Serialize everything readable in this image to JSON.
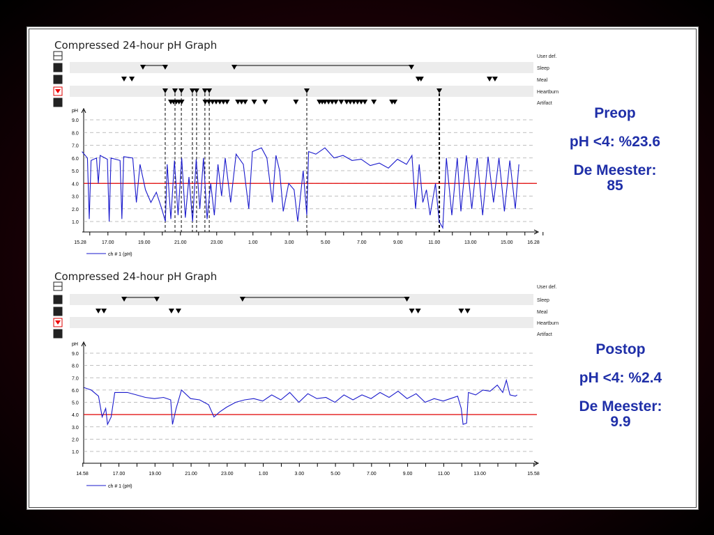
{
  "chart_data": [
    {
      "type": "line",
      "title": "Compressed 24-hour pH Graph",
      "row_labels": [
        "User def.",
        "Sleep",
        "Meal",
        "Heartburn",
        "Artifact"
      ],
      "ylabel": "pH",
      "ylim": [
        0,
        10
      ],
      "yticks": [
        "1.0",
        "2.0",
        "3.0",
        "4.0",
        "5.0",
        "6.0",
        "7.0",
        "8.0",
        "9.0"
      ],
      "threshold": 4.0,
      "xlim_hours": [
        0,
        25
      ],
      "xticks": [
        {
          "h": 0,
          "label": "15.28"
        },
        {
          "h": 1.53,
          "label": "17.00"
        },
        {
          "h": 3.53,
          "label": "19.00"
        },
        {
          "h": 5.53,
          "label": "21.00"
        },
        {
          "h": 7.53,
          "label": "23.00"
        },
        {
          "h": 9.53,
          "label": "1.00"
        },
        {
          "h": 11.53,
          "label": "3.00"
        },
        {
          "h": 13.53,
          "label": "5.00"
        },
        {
          "h": 15.53,
          "label": "7.00"
        },
        {
          "h": 17.53,
          "label": "9.00"
        },
        {
          "h": 19.53,
          "label": "11.00"
        },
        {
          "h": 21.53,
          "label": "13.00"
        },
        {
          "h": 23.53,
          "label": "15.00"
        },
        {
          "h": 25,
          "label": "16.28"
        }
      ],
      "legend": "ch # 1 (pH)",
      "events": {
        "sleep": [
          [
            3.46,
            4.69
          ],
          [
            8.5,
            18.27
          ]
        ],
        "meal": [
          2.42,
          2.85,
          18.65,
          18.8,
          22.58,
          22.88
        ],
        "heartburn": [
          4.69,
          5.23,
          5.58,
          6.19,
          6.42,
          6.88,
          7.12,
          12.5,
          19.81
        ],
        "artifact": [
          5.0,
          5.15,
          5.3,
          5.45,
          5.6,
          6.9,
          7.1,
          7.3,
          7.5,
          7.7,
          7.9,
          8.1,
          8.7,
          8.9,
          9.1,
          9.6,
          10.2,
          11.9,
          13.2,
          13.35,
          13.5,
          13.7,
          13.9,
          14.1,
          14.4,
          14.7,
          14.9,
          15.1,
          15.3,
          15.5,
          15.7,
          16.2,
          17.2,
          17.35
        ]
      },
      "series": [
        {
          "name": "ch # 1 (pH)",
          "points": [
            [
              0.1,
              6.5
            ],
            [
              0.4,
              6.0
            ],
            [
              0.5,
              1.2
            ],
            [
              0.6,
              5.8
            ],
            [
              0.9,
              6.0
            ],
            [
              1.0,
              4.0
            ],
            [
              1.1,
              6.2
            ],
            [
              1.5,
              5.9
            ],
            [
              1.6,
              1.0
            ],
            [
              1.7,
              6.0
            ],
            [
              2.2,
              5.8
            ],
            [
              2.3,
              1.2
            ],
            [
              2.4,
              6.1
            ],
            [
              2.9,
              6.0
            ],
            [
              3.1,
              2.5
            ],
            [
              3.3,
              5.5
            ],
            [
              3.6,
              3.5
            ],
            [
              3.9,
              2.5
            ],
            [
              4.2,
              3.3
            ],
            [
              4.5,
              2.0
            ],
            [
              4.7,
              1.0
            ],
            [
              4.8,
              5.5
            ],
            [
              5.0,
              1.2
            ],
            [
              5.2,
              5.8
            ],
            [
              5.4,
              1.5
            ],
            [
              5.6,
              6.0
            ],
            [
              5.8,
              1.3
            ],
            [
              6.0,
              4.5
            ],
            [
              6.2,
              1.0
            ],
            [
              6.4,
              5.9
            ],
            [
              6.6,
              2.0
            ],
            [
              6.8,
              6.0
            ],
            [
              7.0,
              1.2
            ],
            [
              7.2,
              4.0
            ],
            [
              7.4,
              1.5
            ],
            [
              7.6,
              5.5
            ],
            [
              7.8,
              3.0
            ],
            [
              8.0,
              6.0
            ],
            [
              8.3,
              2.5
            ],
            [
              8.6,
              6.3
            ],
            [
              9.0,
              5.5
            ],
            [
              9.3,
              2.0
            ],
            [
              9.5,
              6.5
            ],
            [
              10.0,
              6.8
            ],
            [
              10.3,
              6.0
            ],
            [
              10.6,
              2.5
            ],
            [
              10.8,
              6.2
            ],
            [
              11.0,
              5.0
            ],
            [
              11.2,
              1.8
            ],
            [
              11.5,
              4.0
            ],
            [
              11.8,
              3.5
            ],
            [
              12.0,
              1.0
            ],
            [
              12.3,
              5.0
            ],
            [
              12.5,
              1.5
            ],
            [
              12.6,
              6.5
            ],
            [
              13.0,
              6.3
            ],
            [
              13.5,
              6.8
            ],
            [
              14.0,
              6.0
            ],
            [
              14.5,
              6.2
            ],
            [
              15.0,
              5.8
            ],
            [
              15.5,
              5.9
            ],
            [
              16.0,
              5.4
            ],
            [
              16.5,
              5.6
            ],
            [
              17.0,
              5.2
            ],
            [
              17.5,
              5.9
            ],
            [
              18.0,
              5.5
            ],
            [
              18.3,
              6.2
            ],
            [
              18.5,
              2.0
            ],
            [
              18.7,
              5.5
            ],
            [
              18.9,
              2.5
            ],
            [
              19.1,
              3.5
            ],
            [
              19.3,
              1.5
            ],
            [
              19.6,
              4.0
            ],
            [
              19.8,
              1.0
            ],
            [
              20.0,
              0.5
            ],
            [
              20.2,
              6.0
            ],
            [
              20.5,
              1.5
            ],
            [
              20.8,
              6.0
            ],
            [
              21.0,
              1.8
            ],
            [
              21.3,
              6.2
            ],
            [
              21.6,
              2.0
            ],
            [
              21.9,
              6.0
            ],
            [
              22.2,
              1.5
            ],
            [
              22.5,
              6.1
            ],
            [
              22.8,
              2.5
            ],
            [
              23.1,
              6.0
            ],
            [
              23.4,
              1.8
            ],
            [
              23.7,
              5.8
            ],
            [
              24.0,
              2.0
            ],
            [
              24.2,
              5.5
            ]
          ]
        }
      ]
    },
    {
      "type": "line",
      "title": "Compressed 24-hour pH Graph",
      "row_labels": [
        "User def.",
        "Sleep",
        "Meal",
        "Heartburn",
        "Artifact"
      ],
      "ylabel": "pH",
      "ylim": [
        0,
        10
      ],
      "yticks": [
        "1.0",
        "2.0",
        "3.0",
        "4.0",
        "5.0",
        "6.0",
        "7.0",
        "8.0",
        "9.0"
      ],
      "threshold": 4.0,
      "xlim_hours": [
        0,
        25
      ],
      "xticks": [
        {
          "h": 0,
          "label": "14.58"
        },
        {
          "h": 2.03,
          "label": "17.00"
        },
        {
          "h": 4.03,
          "label": "19.00"
        },
        {
          "h": 6.03,
          "label": "21.00"
        },
        {
          "h": 8.03,
          "label": "23.00"
        },
        {
          "h": 10.03,
          "label": "1.00"
        },
        {
          "h": 12.03,
          "label": "3.00"
        },
        {
          "h": 14.03,
          "label": "5.00"
        },
        {
          "h": 16.03,
          "label": "7.00"
        },
        {
          "h": 18.03,
          "label": "9.00"
        },
        {
          "h": 20.03,
          "label": "11.00"
        },
        {
          "h": 22.03,
          "label": "13.00"
        },
        {
          "h": 25,
          "label": "15.58"
        }
      ],
      "legend": "ch # 1 (pH)",
      "events": {
        "sleep": [
          [
            2.32,
            4.13
          ],
          [
            8.88,
            17.99
          ]
        ],
        "meal": [
          0.89,
          1.2,
          4.94,
          5.33,
          18.26,
          18.61,
          21.0,
          21.35
        ],
        "heartburn": [],
        "artifact": []
      },
      "series": [
        {
          "name": "ch # 1 (pH)",
          "points": [
            [
              0.1,
              6.2
            ],
            [
              0.5,
              6.0
            ],
            [
              0.9,
              5.5
            ],
            [
              1.1,
              3.8
            ],
            [
              1.3,
              4.5
            ],
            [
              1.4,
              3.2
            ],
            [
              1.6,
              3.8
            ],
            [
              1.8,
              5.8
            ],
            [
              2.5,
              5.8
            ],
            [
              3.0,
              5.6
            ],
            [
              3.5,
              5.4
            ],
            [
              4.0,
              5.3
            ],
            [
              4.5,
              5.4
            ],
            [
              4.9,
              5.2
            ],
            [
              5.0,
              3.2
            ],
            [
              5.2,
              4.5
            ],
            [
              5.5,
              6.0
            ],
            [
              6.0,
              5.3
            ],
            [
              6.5,
              5.2
            ],
            [
              7.0,
              4.8
            ],
            [
              7.3,
              3.8
            ],
            [
              7.6,
              4.2
            ],
            [
              8.0,
              4.6
            ],
            [
              8.5,
              5.0
            ],
            [
              9.0,
              5.2
            ],
            [
              9.5,
              5.3
            ],
            [
              10.0,
              5.1
            ],
            [
              10.5,
              5.6
            ],
            [
              11.0,
              5.2
            ],
            [
              11.5,
              5.8
            ],
            [
              12.0,
              5.0
            ],
            [
              12.5,
              5.7
            ],
            [
              13.0,
              5.3
            ],
            [
              13.5,
              5.4
            ],
            [
              14.0,
              5.0
            ],
            [
              14.5,
              5.6
            ],
            [
              15.0,
              5.2
            ],
            [
              15.5,
              5.6
            ],
            [
              16.0,
              5.3
            ],
            [
              16.5,
              5.8
            ],
            [
              17.0,
              5.4
            ],
            [
              17.5,
              5.9
            ],
            [
              18.0,
              5.3
            ],
            [
              18.5,
              5.7
            ],
            [
              19.0,
              5.0
            ],
            [
              19.5,
              5.3
            ],
            [
              20.0,
              5.1
            ],
            [
              20.4,
              5.3
            ],
            [
              20.8,
              5.5
            ],
            [
              21.0,
              4.5
            ],
            [
              21.1,
              3.2
            ],
            [
              21.3,
              3.3
            ],
            [
              21.4,
              5.8
            ],
            [
              21.8,
              5.6
            ],
            [
              22.2,
              6.0
            ],
            [
              22.6,
              5.9
            ],
            [
              23.0,
              6.4
            ],
            [
              23.3,
              5.8
            ],
            [
              23.5,
              6.8
            ],
            [
              23.7,
              5.6
            ],
            [
              24.0,
              5.5
            ],
            [
              24.1,
              5.6
            ]
          ]
        }
      ]
    }
  ],
  "annotations": [
    {
      "label": "Preop",
      "stat": "pH <4: %23.6",
      "score_label": "De Meester:",
      "score": "85"
    },
    {
      "label": "Postop",
      "stat": "pH <4: %2.4",
      "score_label": "De Meester:",
      "score": "9.9"
    }
  ],
  "colors": {
    "trace": "#1a1acc",
    "threshold": "#e00000",
    "annotation": "#1f2fa8"
  }
}
